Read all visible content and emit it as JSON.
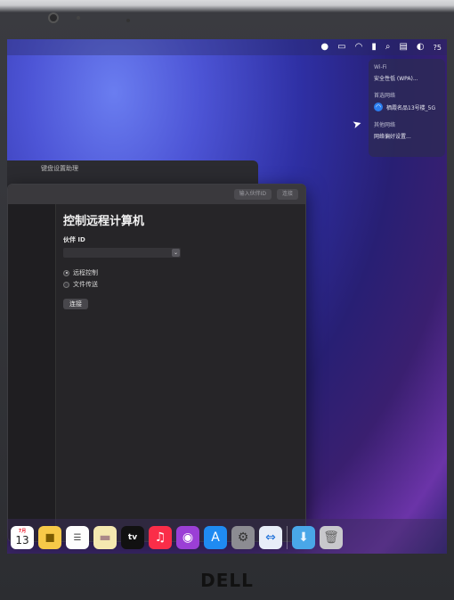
{
  "menubar": {
    "wifi_icon": "wifi-icon",
    "time": "?5"
  },
  "wifi_menu": {
    "title": "Wi-Fi",
    "network_row": "安全性低 (WPA)...",
    "known_title": "首选网络",
    "network_name": "栖霞名品13号楼_5G",
    "other_title": "其他网络",
    "settings": "网络偏好设置..."
  },
  "back_window": {
    "title": "键盘设置助理"
  },
  "main_window": {
    "toolbar_buttons": [
      "输入伙伴ID",
      "连接"
    ],
    "heading": "控制远程计算机",
    "partner_id_label": "伙伴 ID",
    "partner_id_value": "",
    "options": [
      "远程控制",
      "文件传送"
    ],
    "selected_option": "远程控制",
    "connect_button": "连接"
  },
  "dock": {
    "calendar": {
      "month": "7月",
      "day": "13"
    },
    "tv_label": "tv"
  },
  "brand": "DELL"
}
